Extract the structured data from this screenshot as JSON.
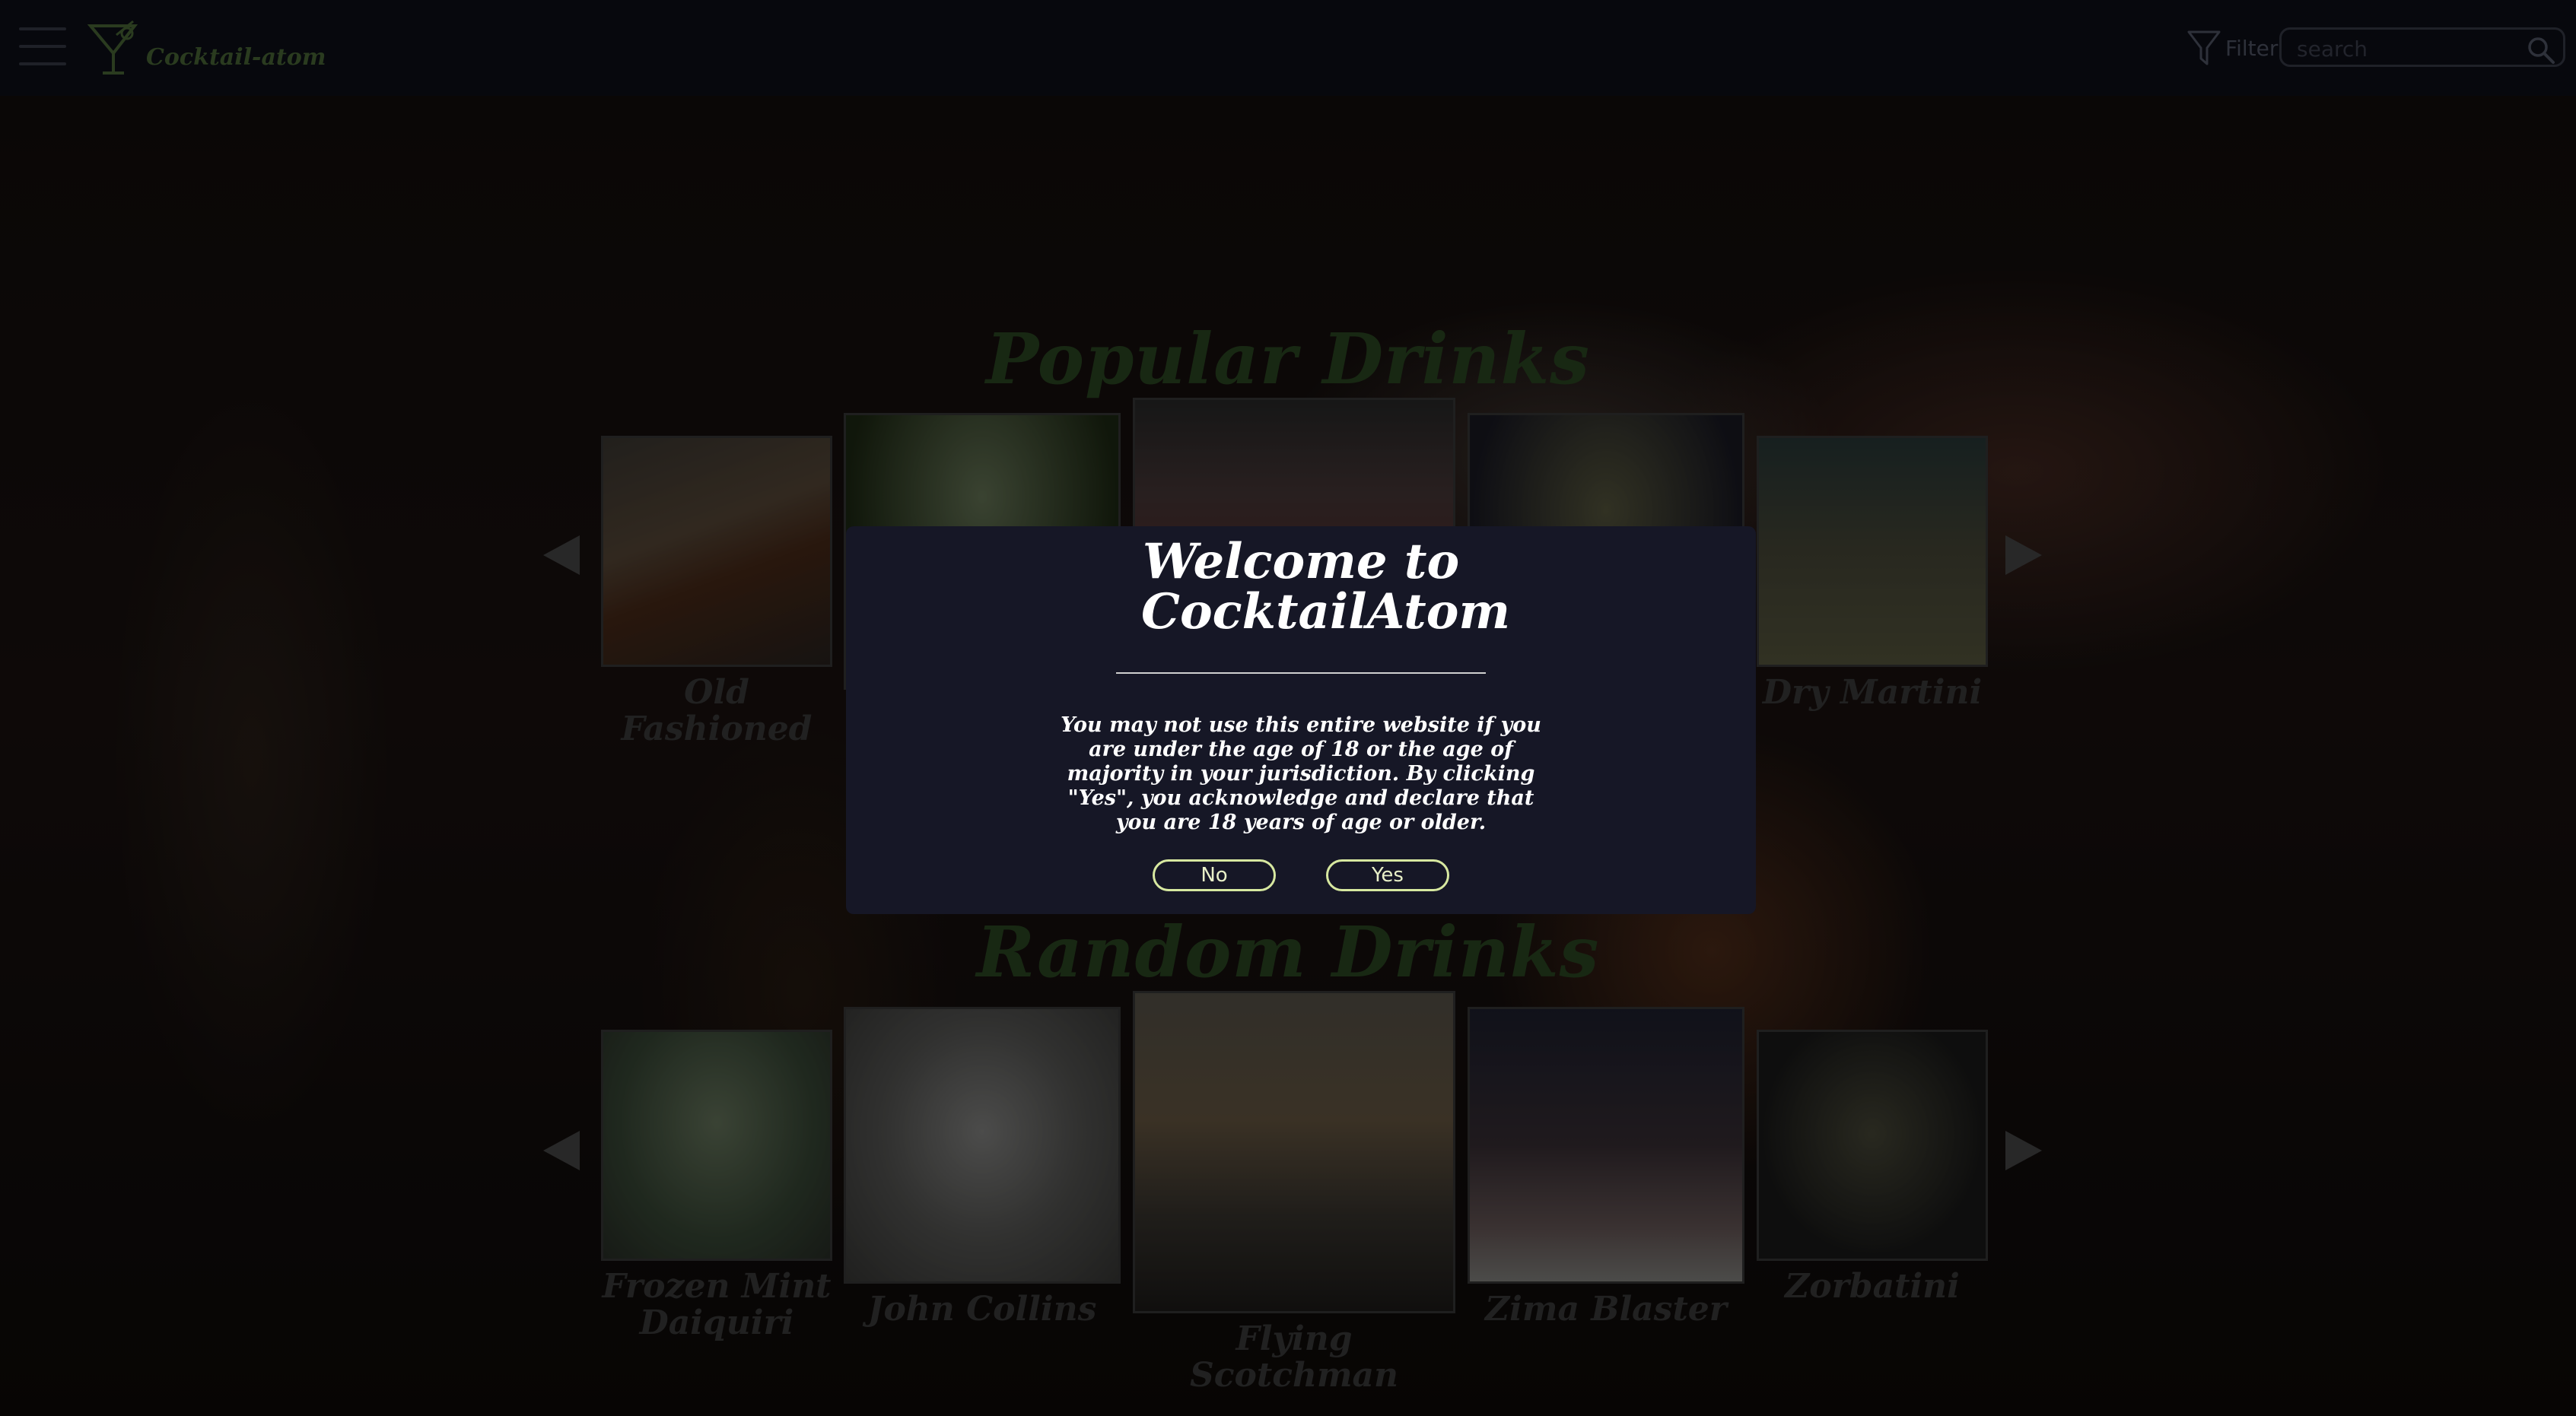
{
  "header": {
    "app_name": "Cocktail-atom",
    "filter_label": "Filter",
    "search_placeholder": "search"
  },
  "popular": {
    "title": "Popular Drinks",
    "drinks": [
      {
        "name": "Old Fashioned"
      },
      {
        "name": ""
      },
      {
        "name": ""
      },
      {
        "name": ""
      },
      {
        "name": "Dry Martini"
      }
    ]
  },
  "random": {
    "title": "Random Drinks",
    "drinks": [
      {
        "name": "Frozen Mint Daiquiri"
      },
      {
        "name": "John Collins"
      },
      {
        "name": "Flying Scotchman"
      },
      {
        "name": "Zima Blaster"
      },
      {
        "name": "Zorbatini"
      }
    ]
  },
  "modal": {
    "title": "Welcome to CocktailAtom",
    "body": "You may not use this entire website if you are under the age of 18 or the age of majority in your jurisdiction. By clicking \"Yes\", you acknowledge and declare that you are 18 years of age or older.",
    "no_label": "No",
    "yes_label": "Yes"
  },
  "colors": {
    "header_bg": "#0d0f19",
    "modal_bg": "#161726",
    "button_border": "#d7e8a0",
    "section_title": "#2d4a24",
    "logo_green": "#4d6c3a"
  }
}
